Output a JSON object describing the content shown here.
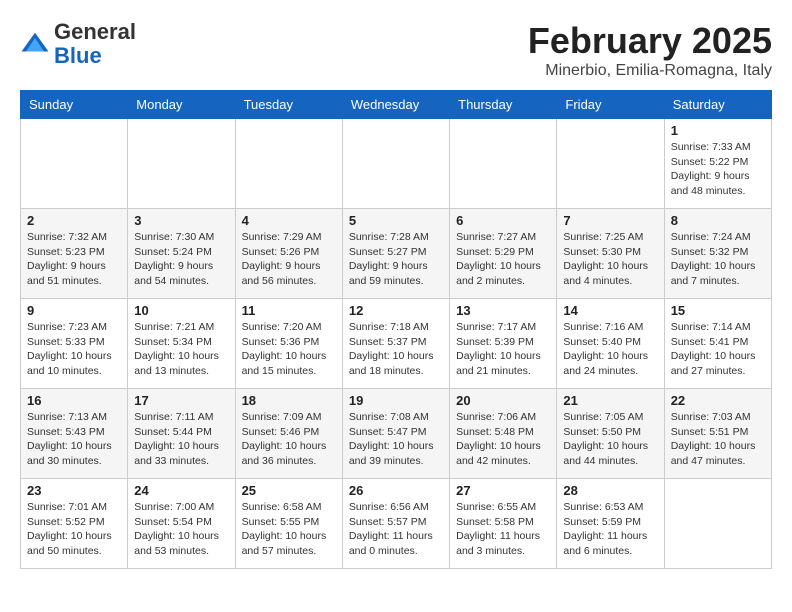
{
  "header": {
    "logo": {
      "general": "General",
      "blue": "Blue"
    },
    "title": "February 2025",
    "location": "Minerbio, Emilia-Romagna, Italy"
  },
  "calendar": {
    "days_of_week": [
      "Sunday",
      "Monday",
      "Tuesday",
      "Wednesday",
      "Thursday",
      "Friday",
      "Saturday"
    ],
    "weeks": [
      [
        {
          "day": "",
          "info": ""
        },
        {
          "day": "",
          "info": ""
        },
        {
          "day": "",
          "info": ""
        },
        {
          "day": "",
          "info": ""
        },
        {
          "day": "",
          "info": ""
        },
        {
          "day": "",
          "info": ""
        },
        {
          "day": "1",
          "info": "Sunrise: 7:33 AM\nSunset: 5:22 PM\nDaylight: 9 hours and 48 minutes."
        }
      ],
      [
        {
          "day": "2",
          "info": "Sunrise: 7:32 AM\nSunset: 5:23 PM\nDaylight: 9 hours and 51 minutes."
        },
        {
          "day": "3",
          "info": "Sunrise: 7:30 AM\nSunset: 5:24 PM\nDaylight: 9 hours and 54 minutes."
        },
        {
          "day": "4",
          "info": "Sunrise: 7:29 AM\nSunset: 5:26 PM\nDaylight: 9 hours and 56 minutes."
        },
        {
          "day": "5",
          "info": "Sunrise: 7:28 AM\nSunset: 5:27 PM\nDaylight: 9 hours and 59 minutes."
        },
        {
          "day": "6",
          "info": "Sunrise: 7:27 AM\nSunset: 5:29 PM\nDaylight: 10 hours and 2 minutes."
        },
        {
          "day": "7",
          "info": "Sunrise: 7:25 AM\nSunset: 5:30 PM\nDaylight: 10 hours and 4 minutes."
        },
        {
          "day": "8",
          "info": "Sunrise: 7:24 AM\nSunset: 5:32 PM\nDaylight: 10 hours and 7 minutes."
        }
      ],
      [
        {
          "day": "9",
          "info": "Sunrise: 7:23 AM\nSunset: 5:33 PM\nDaylight: 10 hours and 10 minutes."
        },
        {
          "day": "10",
          "info": "Sunrise: 7:21 AM\nSunset: 5:34 PM\nDaylight: 10 hours and 13 minutes."
        },
        {
          "day": "11",
          "info": "Sunrise: 7:20 AM\nSunset: 5:36 PM\nDaylight: 10 hours and 15 minutes."
        },
        {
          "day": "12",
          "info": "Sunrise: 7:18 AM\nSunset: 5:37 PM\nDaylight: 10 hours and 18 minutes."
        },
        {
          "day": "13",
          "info": "Sunrise: 7:17 AM\nSunset: 5:39 PM\nDaylight: 10 hours and 21 minutes."
        },
        {
          "day": "14",
          "info": "Sunrise: 7:16 AM\nSunset: 5:40 PM\nDaylight: 10 hours and 24 minutes."
        },
        {
          "day": "15",
          "info": "Sunrise: 7:14 AM\nSunset: 5:41 PM\nDaylight: 10 hours and 27 minutes."
        }
      ],
      [
        {
          "day": "16",
          "info": "Sunrise: 7:13 AM\nSunset: 5:43 PM\nDaylight: 10 hours and 30 minutes."
        },
        {
          "day": "17",
          "info": "Sunrise: 7:11 AM\nSunset: 5:44 PM\nDaylight: 10 hours and 33 minutes."
        },
        {
          "day": "18",
          "info": "Sunrise: 7:09 AM\nSunset: 5:46 PM\nDaylight: 10 hours and 36 minutes."
        },
        {
          "day": "19",
          "info": "Sunrise: 7:08 AM\nSunset: 5:47 PM\nDaylight: 10 hours and 39 minutes."
        },
        {
          "day": "20",
          "info": "Sunrise: 7:06 AM\nSunset: 5:48 PM\nDaylight: 10 hours and 42 minutes."
        },
        {
          "day": "21",
          "info": "Sunrise: 7:05 AM\nSunset: 5:50 PM\nDaylight: 10 hours and 44 minutes."
        },
        {
          "day": "22",
          "info": "Sunrise: 7:03 AM\nSunset: 5:51 PM\nDaylight: 10 hours and 47 minutes."
        }
      ],
      [
        {
          "day": "23",
          "info": "Sunrise: 7:01 AM\nSunset: 5:52 PM\nDaylight: 10 hours and 50 minutes."
        },
        {
          "day": "24",
          "info": "Sunrise: 7:00 AM\nSunset: 5:54 PM\nDaylight: 10 hours and 53 minutes."
        },
        {
          "day": "25",
          "info": "Sunrise: 6:58 AM\nSunset: 5:55 PM\nDaylight: 10 hours and 57 minutes."
        },
        {
          "day": "26",
          "info": "Sunrise: 6:56 AM\nSunset: 5:57 PM\nDaylight: 11 hours and 0 minutes."
        },
        {
          "day": "27",
          "info": "Sunrise: 6:55 AM\nSunset: 5:58 PM\nDaylight: 11 hours and 3 minutes."
        },
        {
          "day": "28",
          "info": "Sunrise: 6:53 AM\nSunset: 5:59 PM\nDaylight: 11 hours and 6 minutes."
        },
        {
          "day": "",
          "info": ""
        }
      ]
    ]
  }
}
